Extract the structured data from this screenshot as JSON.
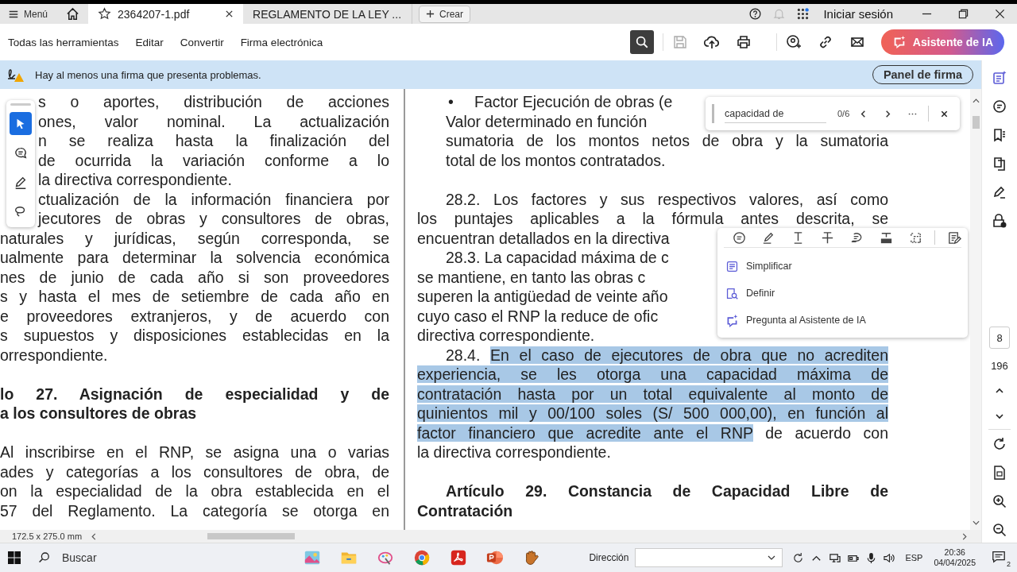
{
  "title_bar": {
    "menu_label": "Menú",
    "tabs": [
      {
        "label": "2364207-1.pdf",
        "selected": true,
        "closable": true
      },
      {
        "label": "REGLAMENTO DE LA LEY ...",
        "selected": false,
        "closable": false
      }
    ],
    "create_label": "Crear",
    "sign_in": "Iniciar sesión",
    "apps_badge": true
  },
  "toolbar": {
    "menus": [
      "Todas las herramientas",
      "Editar",
      "Convertir",
      "Firma electrónica"
    ],
    "search_active": true,
    "save_disabled": true,
    "ai_button": "Asistente de IA"
  },
  "banner": {
    "message": "Hay al menos una firma que presenta problemas.",
    "button": "Panel de firma"
  },
  "tool_palette": {
    "tools": [
      {
        "kind": "select",
        "selected": true
      },
      {
        "kind": "comment",
        "selected": false
      },
      {
        "kind": "draw",
        "selected": false
      },
      {
        "kind": "lasso",
        "selected": false
      }
    ]
  },
  "left_page": {
    "lines": [
      {
        "kind": "full",
        "behind_tools": true,
        "text": "s o aportes, distribución de acciones"
      },
      {
        "kind": "full",
        "behind_tools": true,
        "text": "ones, valor nominal. La actualización"
      },
      {
        "kind": "full",
        "behind_tools": true,
        "text": "n se realiza hasta la finalización del"
      },
      {
        "kind": "full",
        "behind_tools": true,
        "text": "de ocurrida la variación conforme a lo"
      },
      {
        "kind": "end",
        "behind_tools": true,
        "text": "la directiva correspondiente."
      },
      {
        "kind": "full",
        "behind_tools": true,
        "text": "ctualización de la información financiera por"
      },
      {
        "kind": "full",
        "behind_tools": true,
        "text": "jecutores de obras y consultores de obras,"
      },
      {
        "kind": "full",
        "text": "naturales y jurídicas, según corresponda, se"
      },
      {
        "kind": "full",
        "text": "ualmente para determinar la solvencia económica"
      },
      {
        "kind": "full",
        "text": "nes de junio de cada año si son proveedores"
      },
      {
        "kind": "full",
        "text": "s y hasta el mes de setiembre de cada año en"
      },
      {
        "kind": "full",
        "text": "e proveedores extranjeros, y de acuerdo con"
      },
      {
        "kind": "full",
        "text": "s supuestos y disposiciones establecidas en la"
      },
      {
        "kind": "end",
        "text": "orrespondiente."
      },
      {
        "kind": "heading",
        "gap_before": true,
        "text": "lo 27. Asignación de especialidad y de"
      },
      {
        "kind": "heading-end",
        "text": "a los consultores de obras"
      },
      {
        "kind": "full",
        "gap_before": true,
        "text": "Al inscribirse en el RNP, se asigna una o varias"
      },
      {
        "kind": "full",
        "text": "ades y categorías a los consultores de obra, de"
      },
      {
        "kind": "full",
        "text": "on la especialidad de la obra establecida en el"
      },
      {
        "kind": "full",
        "text": "57 del Reglamento. La categoría se otorga en"
      }
    ]
  },
  "right_page": {
    "lines": [
      {
        "kind": "bullet",
        "bullet": "•",
        "indent": false,
        "segments": [
          {
            "text": "Factor Ejecución de obras (e",
            "selected": false
          }
        ]
      },
      {
        "kind": "cut",
        "indent": true,
        "segments": [
          {
            "text": "Valor determinado en función",
            "selected": false
          }
        ]
      },
      {
        "kind": "full",
        "indent": true,
        "segments": [
          {
            "text": "sumatoria de los montos netos de obra y la sumatoria",
            "selected": false
          }
        ]
      },
      {
        "kind": "end",
        "indent": true,
        "segments": [
          {
            "text": "total de los montos contratados.",
            "selected": false
          }
        ]
      },
      {
        "kind": "full",
        "indent": true,
        "gap_before": true,
        "segments": [
          {
            "text": "28.2. Los factores y sus respectivos valores, así como",
            "selected": false
          }
        ]
      },
      {
        "kind": "full",
        "indent": false,
        "segments": [
          {
            "text": "los puntajes aplicables a la fórmula antes descrita, se",
            "selected": false
          }
        ]
      },
      {
        "kind": "cut",
        "indent": false,
        "segments": [
          {
            "text": "encuentran detallados en la directiva",
            "selected": false
          }
        ]
      },
      {
        "kind": "cut",
        "indent": true,
        "segments": [
          {
            "text": "28.3. La capacidad máxima de c",
            "selected": false
          }
        ]
      },
      {
        "kind": "cut",
        "indent": false,
        "segments": [
          {
            "text": "se mantiene, en tanto las obras c",
            "selected": false
          }
        ]
      },
      {
        "kind": "cut",
        "indent": false,
        "segments": [
          {
            "text": "superen la antigüedad de veinte año",
            "selected": false
          }
        ]
      },
      {
        "kind": "cut",
        "indent": false,
        "segments": [
          {
            "text": "cuyo caso el RNP la reduce de ofic",
            "selected": false
          }
        ]
      },
      {
        "kind": "end",
        "indent": false,
        "segments": [
          {
            "text": "directiva correspondiente.",
            "selected": false
          }
        ]
      },
      {
        "kind": "full",
        "indent": true,
        "segments": [
          {
            "text": "28.4. ",
            "selected": false
          },
          {
            "text": "En el caso de ejecutores de obra que no acrediten",
            "selected": true
          }
        ]
      },
      {
        "kind": "full",
        "indent": false,
        "segments": [
          {
            "text": "experiencia, se les otorga una capacidad máxima de",
            "selected": true
          }
        ]
      },
      {
        "kind": "full",
        "indent": false,
        "segments": [
          {
            "text": "contratación hasta por un total equivalente al monto de",
            "selected": true
          }
        ]
      },
      {
        "kind": "full",
        "indent": false,
        "segments": [
          {
            "text": "quinientos mil y 00/100 soles (S/ 500 000,00), en función al",
            "selected": true
          }
        ]
      },
      {
        "kind": "full",
        "indent": false,
        "segments": [
          {
            "text": "factor financiero que acredite ante el RNP",
            "selected": true
          },
          {
            "text": " de acuerdo con",
            "selected": false
          }
        ]
      },
      {
        "kind": "end",
        "indent": false,
        "segments": [
          {
            "text": "la directiva correspondiente.",
            "selected": false
          }
        ]
      },
      {
        "kind": "heading",
        "indent": true,
        "gap_before": true,
        "segments": [
          {
            "text": "Artículo 29. Constancia de Capacidad Libre de",
            "selected": false
          }
        ]
      },
      {
        "kind": "heading-end",
        "indent": false,
        "segments": [
          {
            "text": "Contratación",
            "selected": false
          }
        ]
      }
    ]
  },
  "find_bar": {
    "query": "capacidad de",
    "count": "0/6"
  },
  "selection_menu": {
    "actions": [
      {
        "kind": "simplify",
        "label": "Simplificar"
      },
      {
        "kind": "define",
        "label": "Definir"
      },
      {
        "kind": "ask",
        "label": "Pregunta al Asistente de IA"
      }
    ]
  },
  "side_panel": {
    "page_number": "8",
    "page_count": "196"
  },
  "status": {
    "page_size": "172.5 x 275.0 mm"
  },
  "taskbar": {
    "search_placeholder": "Buscar",
    "apps": [
      {
        "kind": "snip"
      },
      {
        "kind": "folder"
      },
      {
        "kind": "paint"
      },
      {
        "kind": "chrome"
      },
      {
        "kind": "acrobat"
      },
      {
        "kind": "powerpoint"
      },
      {
        "kind": "glove"
      }
    ],
    "address_label": "Dirección",
    "language": "ESP",
    "time": "20:36",
    "date": "04/04/2025",
    "notifications": "2"
  }
}
